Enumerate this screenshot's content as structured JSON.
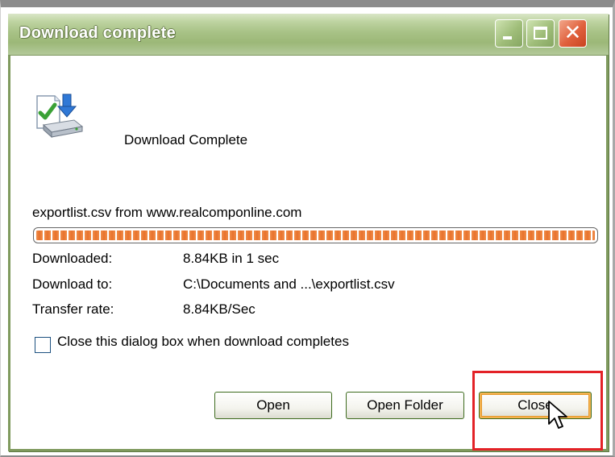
{
  "window": {
    "title": "Download complete",
    "buttons": {
      "minimize_icon": "minimize-icon",
      "maximize_icon": "maximize-icon",
      "close_icon": "close-x-icon",
      "close_glyph": "✕"
    }
  },
  "header": {
    "icon": "download-complete-icon",
    "text": "Download Complete"
  },
  "source": {
    "text": "exportlist.csv from www.realcomponline.com"
  },
  "progress": {
    "value_percent": 100,
    "color": "#e8722c"
  },
  "details": [
    {
      "label": "Downloaded:",
      "value": "8.84KB in 1 sec"
    },
    {
      "label": "Download to:",
      "value": "C:\\Documents and ...\\exportlist.csv"
    },
    {
      "label": "Transfer rate:",
      "value": "8.84KB/Sec"
    }
  ],
  "options": {
    "close_when_done_label": "Close this dialog box when download completes",
    "close_when_done_checked": false
  },
  "actions": {
    "open_label": "Open",
    "open_folder_label": "Open Folder",
    "close_label": "Close"
  },
  "colors": {
    "titlebar_green": "#9cb878",
    "close_red": "#e0603c",
    "highlight_red": "#e32227",
    "focus_orange": "#f4b350"
  }
}
